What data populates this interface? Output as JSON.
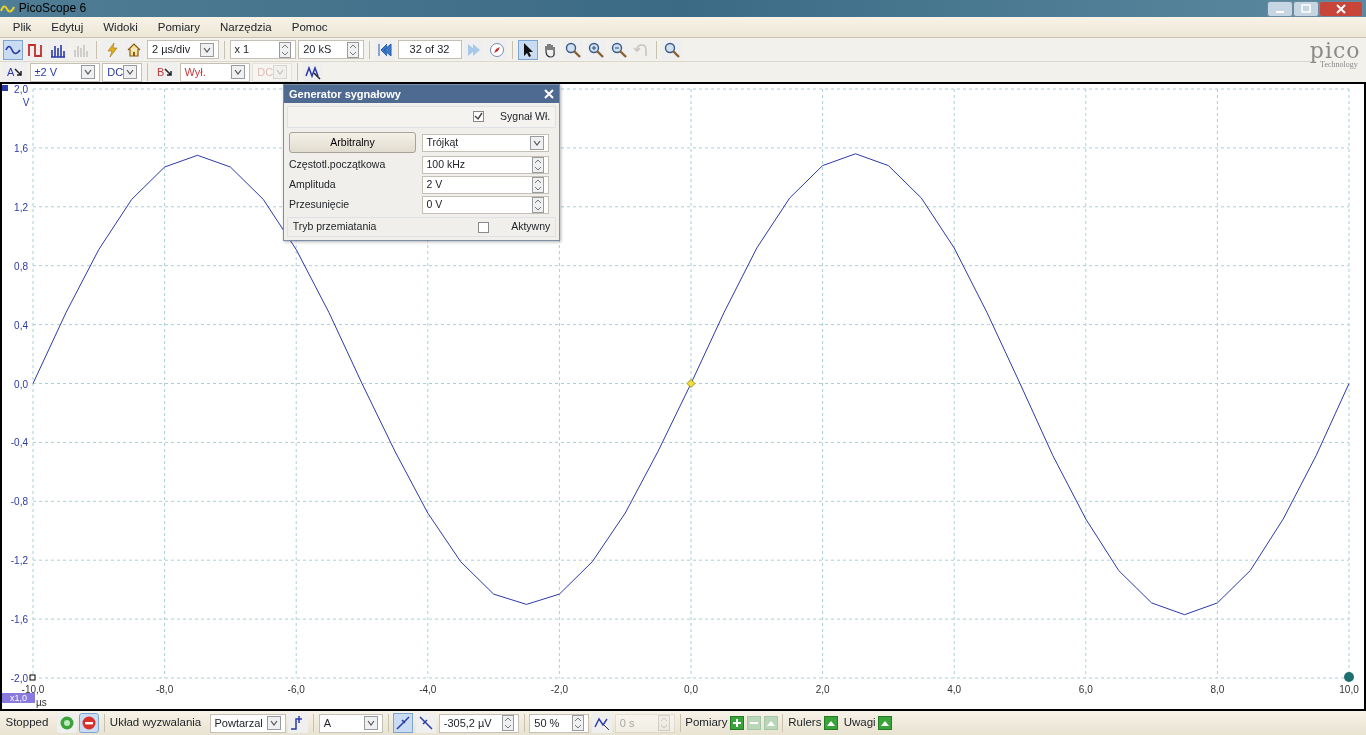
{
  "window": {
    "title": "PicoScope 6"
  },
  "menu": [
    "Plik",
    "Edytuj",
    "Widoki",
    "Pomiary",
    "Narzędzia",
    "Pomoc"
  ],
  "modes": [
    {
      "selected": true,
      "disabled": false
    },
    {
      "selected": false,
      "disabled": false
    },
    {
      "selected": false,
      "disabled": false
    },
    {
      "selected": false,
      "disabled": true
    }
  ],
  "toolbar": {
    "timebase": "2 µs/div",
    "zoom": "x 1",
    "samples": "20 kS",
    "buffer": "32 of 32"
  },
  "tools": [
    {
      "kind": "pointer",
      "selected": true,
      "disabled": false
    },
    {
      "kind": "hand",
      "selected": false,
      "disabled": false
    },
    {
      "kind": "zoom-area",
      "selected": false,
      "disabled": false
    },
    {
      "kind": "zoom-in",
      "selected": false,
      "disabled": false
    },
    {
      "kind": "zoom-out",
      "selected": false,
      "disabled": false
    },
    {
      "kind": "undo",
      "selected": false,
      "disabled": true
    },
    {
      "kind": "zoom-fit",
      "selected": false,
      "disabled": false
    }
  ],
  "logo": {
    "name": "pico",
    "tagline": "Technology"
  },
  "channels": [
    {
      "name": "A",
      "range": "±2 V",
      "coupling": "DC",
      "coupling_disabled": false,
      "color": "#2b3aa8"
    },
    {
      "name": "B",
      "range": "Wył.",
      "coupling": "DC",
      "coupling_disabled": true,
      "color": "#c8383a"
    }
  ],
  "generator": {
    "title": "Generator sygnałowy",
    "signal_label": "Sygnał Wł.",
    "signal_on": true,
    "mode_button": "Arbitralny",
    "waveform": "Trójkąt",
    "fields": [
      {
        "label": "Częstotl.początkowa",
        "value": "100 kHz"
      },
      {
        "label": "Amplituda",
        "value": "2 V"
      },
      {
        "label": "Przesunięcie",
        "value": "0 V"
      }
    ],
    "sweep": {
      "label": "Tryb przemiatania",
      "checked": false,
      "state_label": "Aktywny"
    }
  },
  "scope": {
    "zoom_tag": "x1,0",
    "chart_data": {
      "type": "line",
      "xlabel": "µs",
      "ylabel": "V",
      "xlim": [
        -10,
        10
      ],
      "ylim": [
        -2,
        2
      ],
      "x": [
        -10,
        -9.5,
        -9,
        -8.5,
        -8,
        -7.5,
        -7,
        -6.5,
        -6,
        -5.5,
        -5,
        -4.5,
        -4,
        -3.5,
        -3,
        -2.5,
        -2,
        -1.5,
        -1,
        -0.5,
        0,
        0.5,
        1,
        1.5,
        2,
        2.5,
        3,
        3.5,
        4,
        4.5,
        5,
        5.5,
        6,
        6.5,
        7,
        7.5,
        8,
        8.5,
        9,
        9.5,
        10
      ],
      "grid": true,
      "series": [
        {
          "color": "#2b3aa8",
          "values": [
            0,
            0.48,
            0.91,
            1.25,
            1.47,
            1.55,
            1.47,
            1.25,
            0.91,
            0.48,
            0,
            -0.46,
            -0.88,
            -1.21,
            -1.43,
            -1.5,
            -1.43,
            -1.21,
            -0.88,
            -0.46,
            0,
            0.48,
            0.92,
            1.26,
            1.48,
            1.56,
            1.48,
            1.26,
            0.92,
            0.48,
            0,
            -0.49,
            -0.92,
            -1.27,
            -1.49,
            -1.57,
            -1.49,
            -1.27,
            -0.92,
            -0.49,
            0
          ]
        }
      ],
      "xticks": [
        {
          "value": -10,
          "label": "-10,0"
        },
        {
          "value": -8,
          "label": "-8,0"
        },
        {
          "value": -6,
          "label": "-6,0"
        },
        {
          "value": -4,
          "label": "-4,0"
        },
        {
          "value": -2,
          "label": "-2,0"
        },
        {
          "value": 0,
          "label": "0,0"
        },
        {
          "value": 2,
          "label": "2,0"
        },
        {
          "value": 4,
          "label": "4,0"
        },
        {
          "value": 6,
          "label": "6,0"
        },
        {
          "value": 8,
          "label": "8,0"
        },
        {
          "value": 10,
          "label": "10,0"
        }
      ],
      "yticks": [
        {
          "value": 2,
          "label": "2,0"
        },
        {
          "value": 1.6,
          "label": "1,6"
        },
        {
          "value": 1.2,
          "label": "1,2"
        },
        {
          "value": 0.8,
          "label": "0,8"
        },
        {
          "value": 0.4,
          "label": "0,4"
        },
        {
          "value": 0,
          "label": "0,0"
        },
        {
          "value": -0.4,
          "label": "-0,4"
        },
        {
          "value": -0.8,
          "label": "-0,8"
        },
        {
          "value": -1.2,
          "label": "-1,2"
        },
        {
          "value": -1.6,
          "label": "-1,6"
        },
        {
          "value": -2,
          "label": "-2,0"
        }
      ]
    }
  },
  "status": {
    "state": "Stopped",
    "run_buttons": [
      {
        "kind": "start",
        "selected": false
      },
      {
        "kind": "stop",
        "selected": true
      }
    ],
    "trigger_label": "Układ wyzwalania",
    "trigger_mode": "Powtarzal",
    "trigger_source": "A",
    "edges": [
      {
        "kind": "rising",
        "selected": true
      },
      {
        "kind": "falling",
        "selected": false
      }
    ],
    "threshold": "-305,2 µV",
    "pretrigger": "50 %",
    "delay": "0 s",
    "delay_disabled": true,
    "measurements": "Pomiary",
    "rulers": "Rulers",
    "notes": "Uwagi"
  }
}
